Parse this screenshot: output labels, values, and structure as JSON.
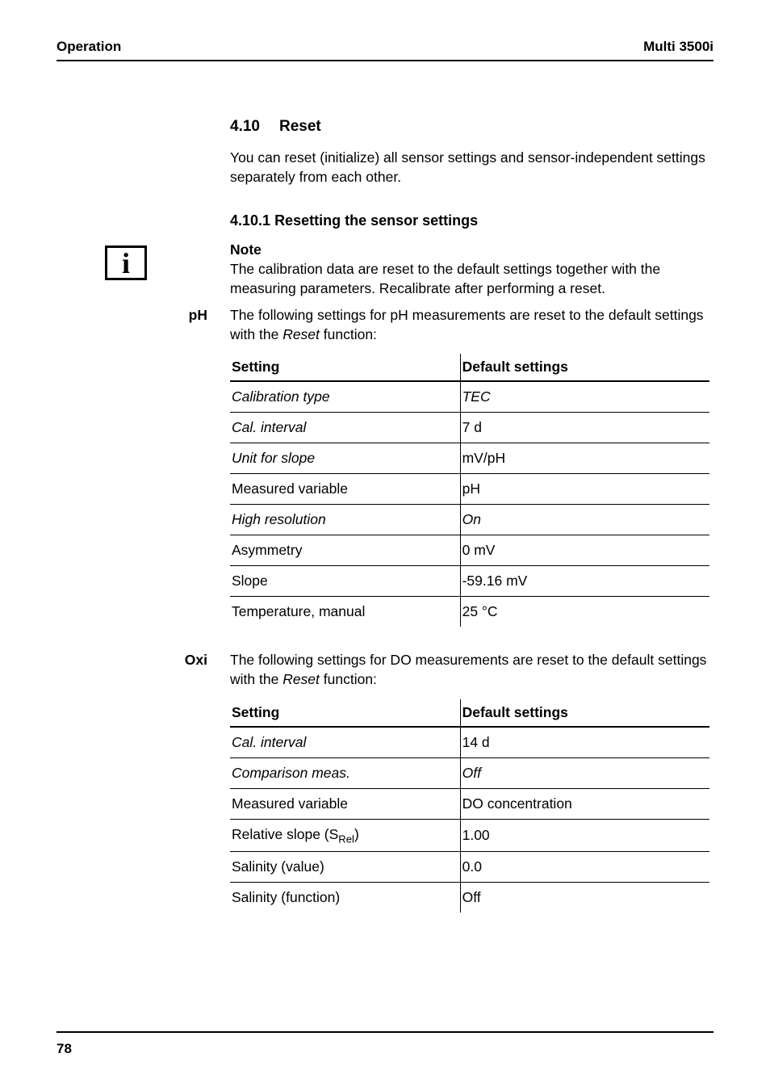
{
  "header": {
    "left": "Operation",
    "right": "Multi 3500i"
  },
  "section": {
    "number": "4.10",
    "title": "Reset",
    "intro": "You can reset (initialize) all sensor settings and sensor-independent settings separately from each other."
  },
  "subsection": {
    "number": "4.10.1",
    "title": "Resetting the sensor settings"
  },
  "note": {
    "label": "Note",
    "text": "The calibration data are reset to the default settings together with the measuring parameters. Recalibrate after performing a reset."
  },
  "ph": {
    "side_label": "pH",
    "intro_pre": "The following settings for pH measurements are reset to the default settings with the ",
    "intro_em": "Reset",
    "intro_post": " function:",
    "table": {
      "col1": "Setting",
      "col2": "Default settings",
      "rows": [
        {
          "setting": "Calibration type",
          "setting_italic": true,
          "value": "TEC",
          "value_italic": true
        },
        {
          "setting": "Cal. interval",
          "setting_italic": true,
          "value": "7 d",
          "value_italic": false
        },
        {
          "setting": "Unit for slope",
          "setting_italic": true,
          "value": "mV/pH",
          "value_italic": false
        },
        {
          "setting": "Measured variable",
          "setting_italic": false,
          "value": "pH",
          "value_italic": false
        },
        {
          "setting": "High resolution",
          "setting_italic": true,
          "value": "On",
          "value_italic": true
        },
        {
          "setting": "Asymmetry",
          "setting_italic": false,
          "value": "0 mV",
          "value_italic": false
        },
        {
          "setting": "Slope",
          "setting_italic": false,
          "value": "-59.16 mV",
          "value_italic": false
        },
        {
          "setting": "Temperature, manual",
          "setting_italic": false,
          "value": "25 °C",
          "value_italic": false
        }
      ]
    }
  },
  "oxi": {
    "side_label": "Oxi",
    "intro_pre": "The following settings for DO measurements are reset to the default settings with the ",
    "intro_em": "Reset",
    "intro_post": " function:",
    "table": {
      "col1": "Setting",
      "col2": "Default settings",
      "rows": [
        {
          "setting": "Cal. interval",
          "setting_italic": true,
          "value": "14 d",
          "value_italic": false,
          "sub": null
        },
        {
          "setting": "Comparison meas.",
          "setting_italic": true,
          "value": "Off",
          "value_italic": true,
          "sub": null
        },
        {
          "setting": "Measured variable",
          "setting_italic": false,
          "value": "DO concentration",
          "value_italic": false,
          "sub": null
        },
        {
          "setting_pre": "Relative slope (S",
          "sub": "Rel",
          "setting_post": ")",
          "setting_italic": false,
          "value": "1.00",
          "value_italic": false
        },
        {
          "setting": "Salinity (value)",
          "setting_italic": false,
          "value": "0.0",
          "value_italic": false,
          "sub": null
        },
        {
          "setting": "Salinity (function)",
          "setting_italic": false,
          "value": "Off",
          "value_italic": false,
          "sub": null
        }
      ]
    }
  },
  "footer": {
    "page_number": "78"
  }
}
